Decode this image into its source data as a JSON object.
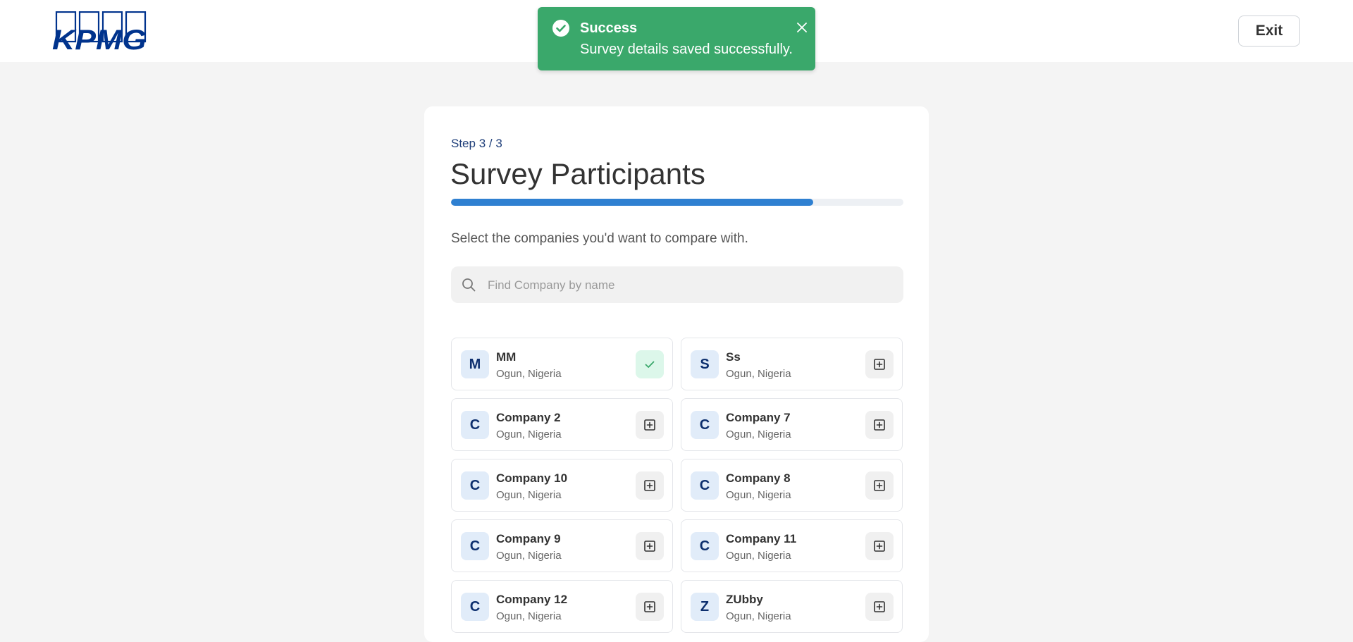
{
  "header": {
    "logo_text": "KPMG",
    "exit_label": "Exit"
  },
  "toast": {
    "title": "Success",
    "message": "Survey details saved successfully.",
    "color": "#3aa86b"
  },
  "main": {
    "step": "Step 3 / 3",
    "title": "Survey Participants",
    "progress": 0.8,
    "subtitle": "Select the companies you'd want to compare with.",
    "search_placeholder": "Find Company by name",
    "search_value": ""
  },
  "companies": [
    {
      "initial": "M",
      "name": "MM",
      "location": "Ogun, Nigeria",
      "selected": true
    },
    {
      "initial": "S",
      "name": "Ss",
      "location": "Ogun, Nigeria",
      "selected": false
    },
    {
      "initial": "C",
      "name": "Company 2",
      "location": "Ogun, Nigeria",
      "selected": false
    },
    {
      "initial": "C",
      "name": "Company 7",
      "location": "Ogun, Nigeria",
      "selected": false
    },
    {
      "initial": "C",
      "name": "Company 10",
      "location": "Ogun, Nigeria",
      "selected": false
    },
    {
      "initial": "C",
      "name": "Company 8",
      "location": "Ogun, Nigeria",
      "selected": false
    },
    {
      "initial": "C",
      "name": "Company 9",
      "location": "Ogun, Nigeria",
      "selected": false
    },
    {
      "initial": "C",
      "name": "Company 11",
      "location": "Ogun, Nigeria",
      "selected": false
    },
    {
      "initial": "C",
      "name": "Company 12",
      "location": "Ogun, Nigeria",
      "selected": false
    },
    {
      "initial": "Z",
      "name": "ZUbby",
      "location": "Ogun, Nigeria",
      "selected": false
    }
  ],
  "colors": {
    "brand": "#00338d",
    "accent": "#2f80d1",
    "success": "#3aa86b"
  },
  "icons": {
    "selected": "check-icon",
    "unselected": "plus-square-icon",
    "search": "search-icon",
    "toast": "check-circle-icon",
    "close": "close-icon"
  }
}
